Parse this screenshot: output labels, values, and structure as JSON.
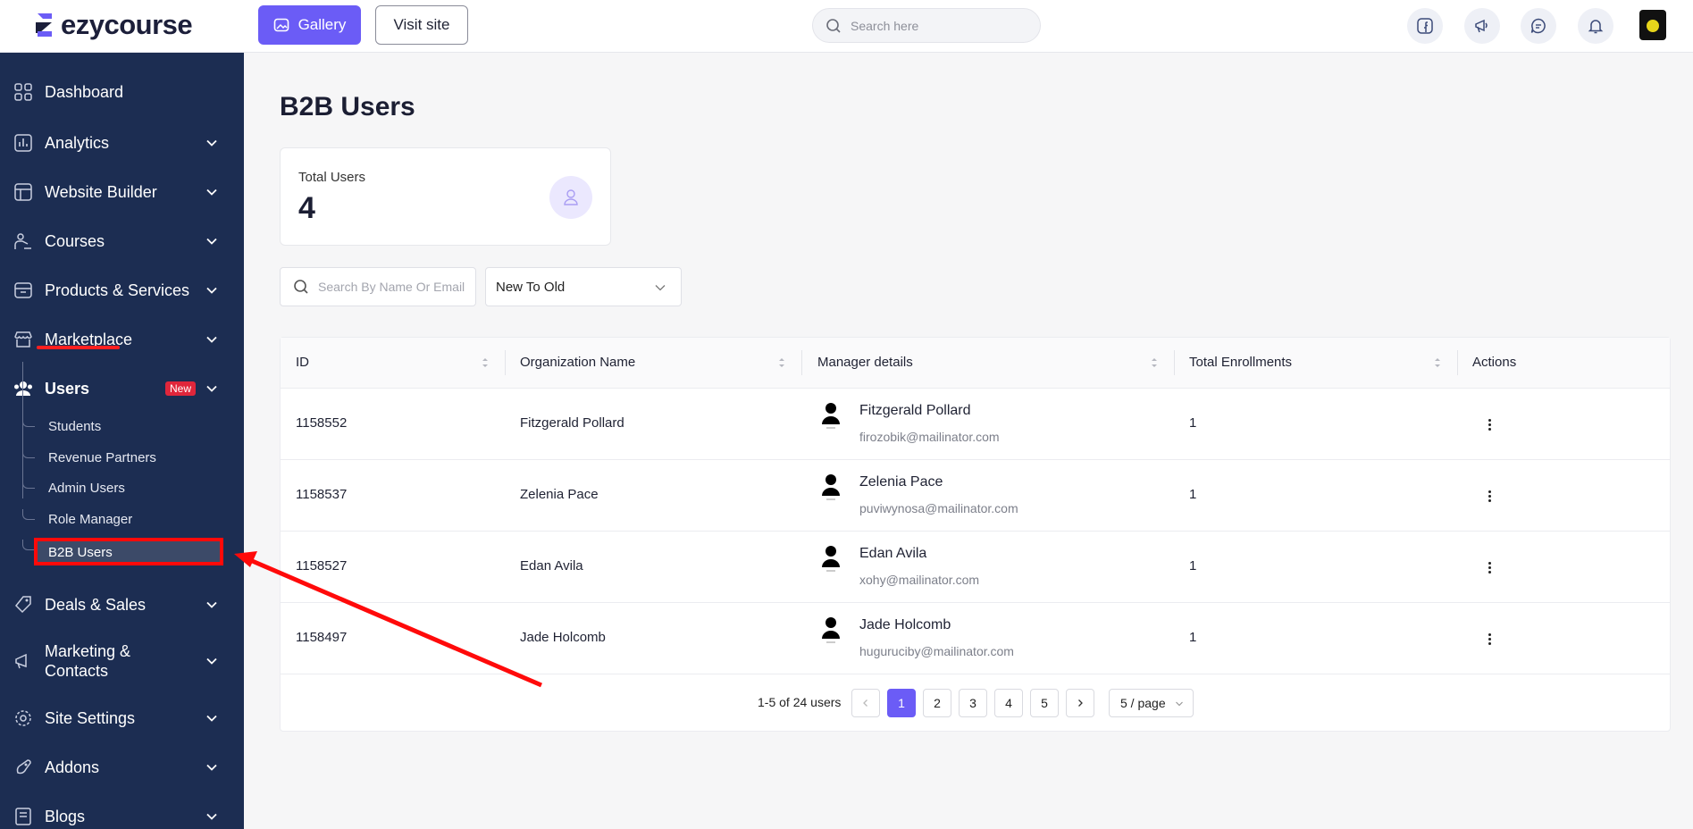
{
  "brand": {
    "name": "ezycourse"
  },
  "topbar": {
    "gallery_label": "Gallery",
    "visit_site_label": "Visit site",
    "search_placeholder": "Search here"
  },
  "sidebar": {
    "items": [
      {
        "label": "Dashboard",
        "icon": "dashboard-icon"
      },
      {
        "label": "Analytics",
        "icon": "analytics-icon"
      },
      {
        "label": "Website Builder",
        "icon": "website-builder-icon"
      },
      {
        "label": "Courses",
        "icon": "courses-icon"
      },
      {
        "label": "Products & Services",
        "icon": "products-icon"
      },
      {
        "label": "Marketplace",
        "icon": "marketplace-icon"
      },
      {
        "label": "Users",
        "icon": "users-icon",
        "badge": "New"
      },
      {
        "label": "Deals & Sales",
        "icon": "deals-icon"
      },
      {
        "label": "Marketing &",
        "label2": "Contacts",
        "icon": "marketing-icon"
      },
      {
        "label": "Site Settings",
        "icon": "settings-icon"
      },
      {
        "label": "Addons",
        "icon": "addons-icon"
      },
      {
        "label": "Blogs",
        "icon": "blogs-icon"
      }
    ],
    "users_submenu": [
      "Students",
      "Revenue Partners",
      "Admin Users",
      "Role Manager",
      "B2B Users"
    ],
    "active_subitem": "B2B Users"
  },
  "main": {
    "title": "B2B Users",
    "stat": {
      "label": "Total Users",
      "value": "4"
    },
    "search_placeholder": "Search By Name Or Email",
    "sort_value": "New To Old",
    "table": {
      "columns": [
        "ID",
        "Organization Name",
        "Manager details",
        "Total Enrollments",
        "Actions"
      ],
      "rows": [
        {
          "id": "1158552",
          "org": "Fitzgerald Pollard",
          "manager": "Fitzgerald Pollard",
          "email": "firozobik@mailinator.com",
          "enrollments": "1"
        },
        {
          "id": "1158537",
          "org": "Zelenia Pace",
          "manager": "Zelenia Pace",
          "email": "puviwynosa@mailinator.com",
          "enrollments": "1"
        },
        {
          "id": "1158527",
          "org": "Edan Avila",
          "manager": "Edan Avila",
          "email": "xohy@mailinator.com",
          "enrollments": "1"
        },
        {
          "id": "1158497",
          "org": "Jade Holcomb",
          "manager": "Jade Holcomb",
          "email": "huguruciby@mailinator.com",
          "enrollments": "1"
        }
      ]
    },
    "pagination": {
      "info": "1-5 of 24 users",
      "pages": [
        "1",
        "2",
        "3",
        "4",
        "5"
      ],
      "current": "1",
      "page_size": "5 / page"
    }
  },
  "colors": {
    "sidebar_bg": "#1c2d52",
    "accent": "#6b5cf6",
    "annotation_red": "#ff0a0a",
    "badge_red": "#e0263b"
  }
}
